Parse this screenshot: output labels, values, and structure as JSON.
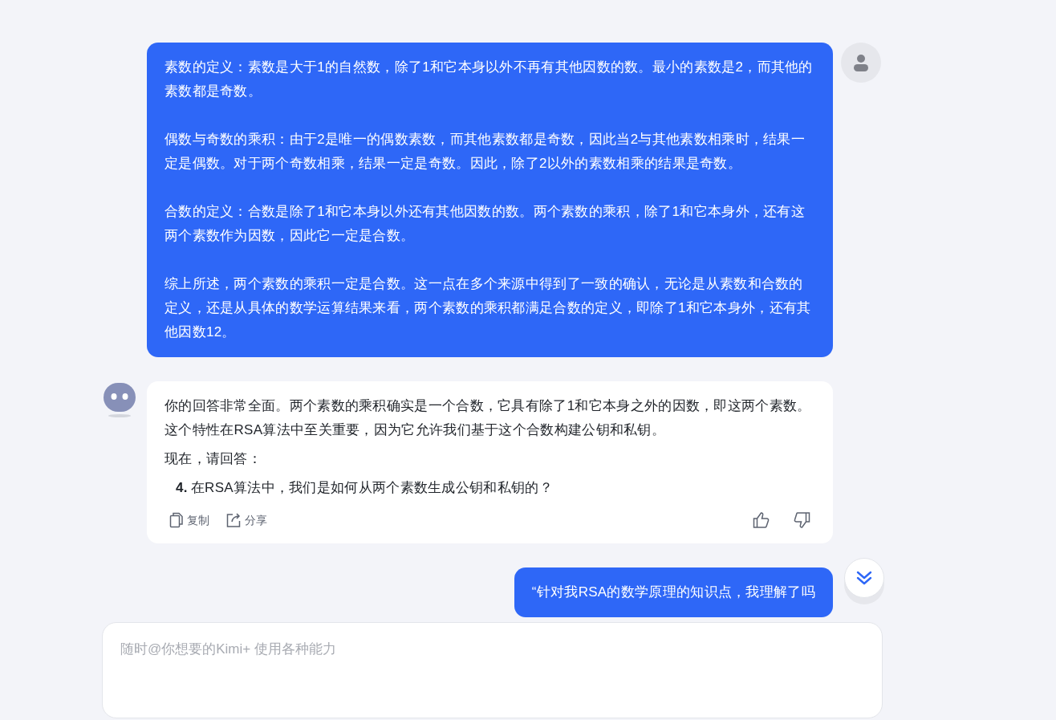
{
  "messages": [
    {
      "kind": "user",
      "paragraphs": [
        "素数的定义：素数是大于1的自然数，除了1和它本身以外不再有其他因数的数。最小的素数是2，而其他的素数都是奇数。",
        "偶数与奇数的乘积：由于2是唯一的偶数素数，而其他素数都是奇数，因此当2与其他素数相乘时，结果一定是偶数。对于两个奇数相乘，结果一定是奇数。因此，除了2以外的素数相乘的结果是奇数。",
        "合数的定义：合数是除了1和它本身以外还有其他因数的数。两个素数的乘积，除了1和它本身外，还有这两个素数作为因数，因此它一定是合数。",
        "综上所述，两个素数的乘积一定是合数。这一点在多个来源中得到了一致的确认，无论是从素数和合数的定义，还是从具体的数学运算结果来看，两个素数的乘积都满足合数的定义，即除了1和它本身外，还有其他因数12。"
      ]
    },
    {
      "kind": "assistant",
      "paragraphs": [
        "你的回答非常全面。两个素数的乘积确实是一个合数，它具有除了1和它本身之外的因数，即这两个素数。这个特性在RSA算法中至关重要，因为它允许我们基于这个合数构建公钥和私钥。",
        "现在，请回答："
      ],
      "list": [
        {
          "number": "4.",
          "text": "在RSA算法中，我们是如何从两个素数生成公钥和私钥的？"
        }
      ],
      "actions": [
        {
          "kind": "copy",
          "label": "复制"
        },
        {
          "kind": "share",
          "label": "分享"
        },
        {
          "kind": "like"
        },
        {
          "kind": "dislike"
        }
      ]
    },
    {
      "kind": "user",
      "paragraphs": [
        "“针对我RSA的数学原理的知识点，我理解了吗"
      ]
    }
  ],
  "composer": {
    "placeholder": "随时@你想要的Kimi+ 使用各种能力"
  }
}
